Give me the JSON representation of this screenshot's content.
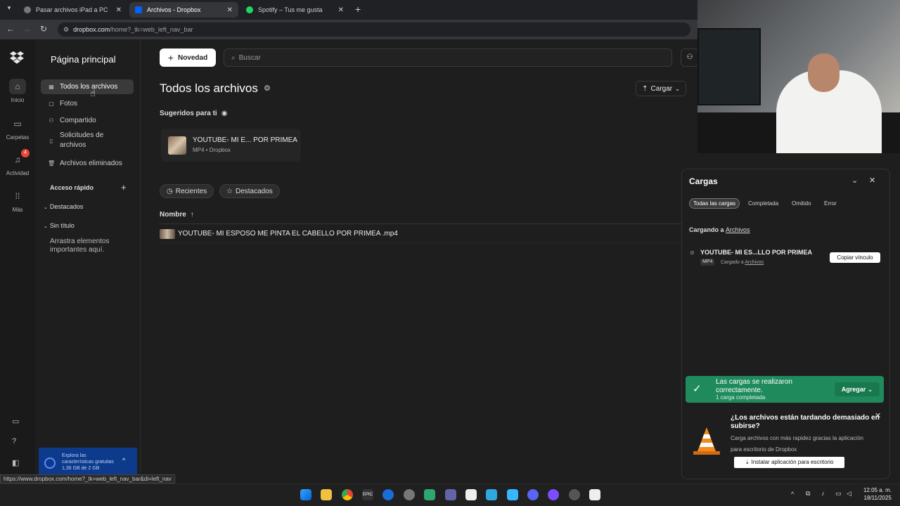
{
  "browser": {
    "tabs": [
      {
        "title": "Pasar archivos iPad a PC",
        "active": false
      },
      {
        "title": "Archivos - Dropbox",
        "active": true
      },
      {
        "title": "Spotify – Tus me gusta",
        "active": false
      }
    ],
    "url_host": "dropbox.com",
    "url_path": "/home?_tk=web_left_nav_bar",
    "status_url": "https://www.dropbox.com/home?_tk=web_left_nav_bar&di=left_nav"
  },
  "rail": {
    "items": [
      {
        "label": "Inicio",
        "icon": "home-icon"
      },
      {
        "label": "Carpetas",
        "icon": "folder-icon"
      },
      {
        "label": "Actividad",
        "icon": "bell-icon",
        "badge": "4"
      },
      {
        "label": "Más",
        "icon": "grid-icon"
      }
    ]
  },
  "sidebar": {
    "title": "Página principal",
    "items": [
      {
        "label": "Todos los archivos",
        "selected": true
      },
      {
        "label": "Fotos"
      },
      {
        "label": "Compartido"
      },
      {
        "label": "Solicitudes de",
        "label2": "archivos"
      },
      {
        "label": "Archivos eliminados"
      }
    ],
    "quick_access": "Acceso rápido",
    "starred": "Destacados",
    "untitled": "Sin título",
    "drag_hint_1": "Arrastra elementos",
    "drag_hint_2": "importantes aquí.",
    "promo_1": "Explora las",
    "promo_2": "características gratuitas",
    "promo_3": "1,36 GB de 2 GB"
  },
  "toolbar": {
    "new_label": "Novedad",
    "search_placeholder": "Buscar",
    "upload_label": "Cargar"
  },
  "main": {
    "title": "Todos los archivos",
    "suggested_label": "Sugeridos para ti",
    "suggested_card": {
      "name": "YOUTUBE- MI E... POR PRIMEA",
      "meta": "MP4 • Dropbox"
    },
    "filter_recent": "Recientes",
    "filter_starred": "Destacados",
    "col_name": "Nombre",
    "files": [
      {
        "name": "YOUTUBE- MI ESPOSO ME PINTA EL CABELLO POR PRIMEA .mp4"
      }
    ]
  },
  "uploads": {
    "title": "Cargas",
    "chips": [
      "Todas las cargas",
      "Completada",
      "Omitido",
      "Error"
    ],
    "uploading_to": "Cargando a",
    "folder": "Archivos",
    "item_name": "YOUTUBE- MI ES...LLO POR PRIMEA",
    "item_type": "MP4",
    "item_dest": "Cargado a",
    "copy_link": "Copiar vínculo"
  },
  "toast": {
    "line1": "Las cargas se realizaron",
    "line2": "correctamente.",
    "sub": "1 carga completada",
    "action": "Agregar"
  },
  "promo_box": {
    "title1": "¿Los archivos están tardando demasiado en",
    "title2": "subirse?",
    "body1": "Carga archivos con más rapidez gracias la aplicación",
    "body2": "para escritorio de Dropbox",
    "button": "Instalar aplicación para escritorio"
  },
  "taskbar": {
    "time": "12:05 a. m.",
    "date": "18/11/2025"
  },
  "colors": {
    "accent_green": "#1f8b5d",
    "dropbox_blue": "#0061fe",
    "badge_red": "#e8453c"
  }
}
